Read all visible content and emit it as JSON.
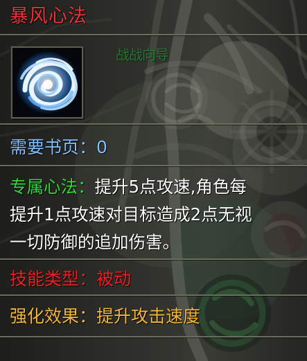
{
  "skill": {
    "title": "暴风心法",
    "icon": "swirl-icon",
    "guide_hint": "战战向导"
  },
  "stats": {
    "pages_label": "需要书页：",
    "pages_value": "0",
    "exclusive_label": "专属心法：",
    "description_line_1": "提升5点攻速,角色每",
    "description_line_2": "提升1点攻速对目标造成2点无视",
    "description_line_3": "一切防御的追加伤害。",
    "type_label": "技能类型：",
    "type_value": "被动",
    "enhance_label": "强化效果：",
    "enhance_value": "提升攻击速度"
  },
  "colors": {
    "title": "#f0313a",
    "pages": "#83bfff",
    "exclusive": "#35d83b",
    "description": "#ffffff",
    "type": "#f11f25",
    "enhance": "#f4b63d",
    "divider": "#6b6d5d"
  }
}
